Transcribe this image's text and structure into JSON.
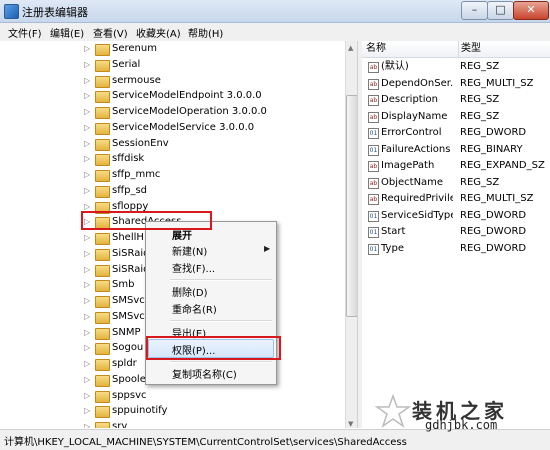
{
  "window": {
    "title": "注册表编辑器"
  },
  "menubar": [
    "文件(F)",
    "编辑(E)",
    "查看(V)",
    "收藏夹(A)",
    "帮助(H)"
  ],
  "tree": {
    "items": [
      {
        "label": "Serenum"
      },
      {
        "label": "Serial"
      },
      {
        "label": "sermouse"
      },
      {
        "label": "ServiceModelEndpoint 3.0.0.0"
      },
      {
        "label": "ServiceModelOperation 3.0.0.0"
      },
      {
        "label": "ServiceModelService 3.0.0.0"
      },
      {
        "label": "SessionEnv"
      },
      {
        "label": "sffdisk"
      },
      {
        "label": "sffp_mmc"
      },
      {
        "label": "sffp_sd"
      },
      {
        "label": "sfloppy"
      },
      {
        "label": "SharedAccess",
        "selected": true
      },
      {
        "label": "ShellH"
      },
      {
        "label": "SiSRaid"
      },
      {
        "label": "SiSRaid"
      },
      {
        "label": "Smb"
      },
      {
        "label": "SMSvc"
      },
      {
        "label": "SMSvc"
      },
      {
        "label": "SNMP"
      },
      {
        "label": "Sogou"
      },
      {
        "label": "spldr"
      },
      {
        "label": "Spooler"
      },
      {
        "label": "sppsvc"
      },
      {
        "label": "sppuinotify"
      },
      {
        "label": "srv"
      }
    ]
  },
  "list": {
    "columns": {
      "name": "名称",
      "type": "类型"
    },
    "rows": [
      {
        "icon": "ab",
        "name": "(默认)",
        "type": "REG_SZ"
      },
      {
        "icon": "ab",
        "name": "DependOnSer...",
        "type": "REG_MULTI_SZ"
      },
      {
        "icon": "ab",
        "name": "Description",
        "type": "REG_SZ"
      },
      {
        "icon": "ab",
        "name": "DisplayName",
        "type": "REG_SZ"
      },
      {
        "icon": "01",
        "name": "ErrorControl",
        "type": "REG_DWORD"
      },
      {
        "icon": "01",
        "name": "FailureActions",
        "type": "REG_BINARY"
      },
      {
        "icon": "ab",
        "name": "ImagePath",
        "type": "REG_EXPAND_SZ"
      },
      {
        "icon": "ab",
        "name": "ObjectName",
        "type": "REG_SZ"
      },
      {
        "icon": "ab",
        "name": "RequiredPrivile...",
        "type": "REG_MULTI_SZ"
      },
      {
        "icon": "01",
        "name": "ServiceSidType",
        "type": "REG_DWORD"
      },
      {
        "icon": "01",
        "name": "Start",
        "type": "REG_DWORD"
      },
      {
        "icon": "01",
        "name": "Type",
        "type": "REG_DWORD"
      }
    ]
  },
  "context_menu": {
    "items": [
      {
        "label": "展开",
        "bold": true
      },
      {
        "label": "新建(N)",
        "submenu": true
      },
      {
        "label": "查找(F)..."
      },
      {
        "label": "删除(D)"
      },
      {
        "label": "重命名(R)"
      },
      {
        "label": "导出(E)"
      },
      {
        "label": "权限(P)...",
        "highlighted": true
      },
      {
        "label": "复制项名称(C)"
      }
    ]
  },
  "statusbar": {
    "path": "计算机\\HKEY_LOCAL_MACHINE\\SYSTEM\\CurrentControlSet\\services\\SharedAccess"
  },
  "watermark": {
    "text": "装机之家",
    "url": "gdhjbk.com"
  },
  "colors": {
    "highlight_box": "#d7191d",
    "folder": "#e3b33e"
  },
  "icons": [
    "registry-app-icon",
    "folder-icon",
    "string-value-icon",
    "binary-value-icon",
    "submenu-arrow-icon"
  ]
}
